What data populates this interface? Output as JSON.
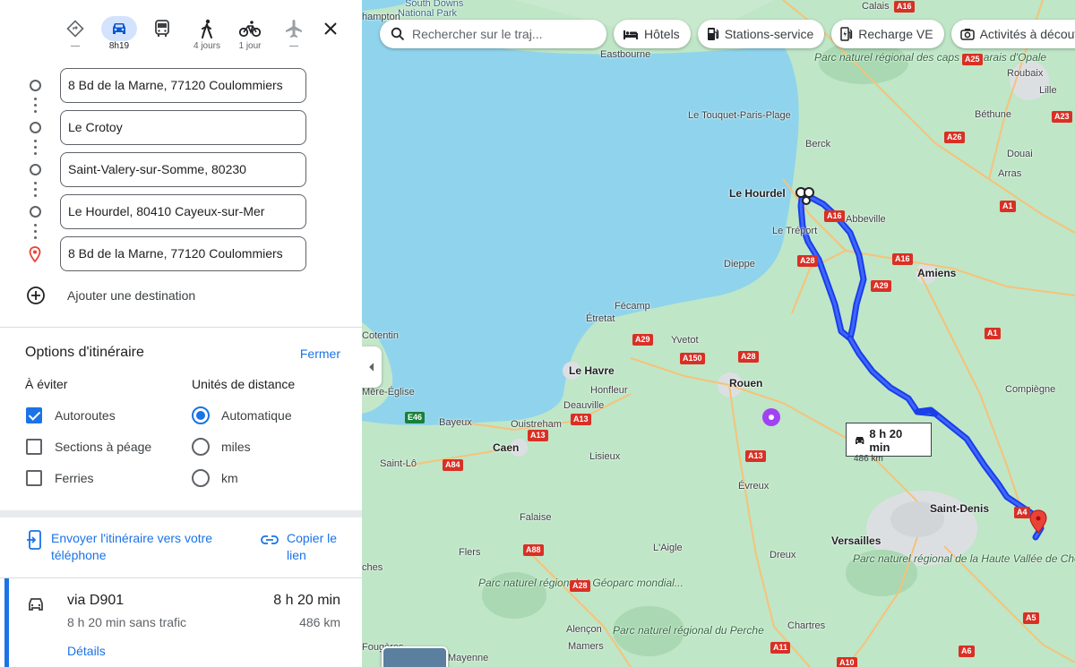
{
  "modes": [
    {
      "name": "best",
      "label": "—"
    },
    {
      "name": "driving",
      "label": "8h19"
    },
    {
      "name": "transit",
      "label": ""
    },
    {
      "name": "walking",
      "label": "4 jours"
    },
    {
      "name": "cycling",
      "label": "1 jour"
    },
    {
      "name": "flights",
      "label": "—"
    }
  ],
  "stops": [
    "8 Bd de la Marne, 77120 Coulommiers",
    "Le Crotoy",
    "Saint-Valery-sur-Somme, 80230",
    "Le Hourdel, 80410 Cayeux-sur-Mer",
    "8 Bd de la Marne, 77120 Coulommiers"
  ],
  "add_destination": "Ajouter une destination",
  "options": {
    "title": "Options d'itinéraire",
    "close": "Fermer",
    "avoid_title": "À éviter",
    "units_title": "Unités de distance",
    "avoid": [
      {
        "label": "Autoroutes",
        "checked": true
      },
      {
        "label": "Sections à péage",
        "checked": false
      },
      {
        "label": "Ferries",
        "checked": false
      }
    ],
    "units": [
      {
        "label": "Automatique",
        "selected": true
      },
      {
        "label": "miles",
        "selected": false
      },
      {
        "label": "km",
        "selected": false
      }
    ]
  },
  "share": {
    "send": "Envoyer l'itinéraire vers votre téléphone",
    "copy": "Copier le lien"
  },
  "route": {
    "via": "via D901",
    "time": "8 h 20 min",
    "sub": "8 h 20 min sans trafic",
    "distance": "486 km",
    "details": "Détails"
  },
  "map": {
    "search_placeholder": "Rechercher sur le traj...",
    "chips": [
      "Hôtels",
      "Stations-service",
      "Recharge VE",
      "Activités à découvrir"
    ],
    "callout_time": "8 h 20 min",
    "callout_distance": "486 km",
    "places": [
      "South Downs",
      "National Park",
      "hampton",
      "Eastbourne",
      "Calais",
      "Roubaix",
      "Lille",
      "Parc naturel régional des caps et marais d'Opale",
      "Le Touquet-Paris-Plage",
      "Béthune",
      "Berck",
      "Douai",
      "Arras",
      "Le Hourdel",
      "Abbeville",
      "Le Tréport",
      "Dieppe",
      "Amiens",
      "Fécamp",
      "Étretat",
      "Yvetot",
      "Cotentin",
      "Le Havre",
      "Honfleur",
      "Rouen",
      "Deauville",
      "Compiègne",
      "Mère-Église",
      "Bayeux",
      "Ouistreham",
      "Caen",
      "Lisieux",
      "Saint-Lô",
      "Évreux",
      "Saint-Denis",
      "Falaise",
      "L'Aigle",
      "Flers",
      "Dreux",
      "Versailles",
      "Parc naturel régional de la Haute Vallée de Chevreuse",
      "ches",
      "Parc naturel régional et Géoparc mondial...",
      "Alençon",
      "Parc naturel régional du Perche",
      "Chartres",
      "Mamers",
      "Fougères",
      "Mayenne"
    ],
    "roads": [
      "A16",
      "A25",
      "A23",
      "A26",
      "A1",
      "A16",
      "A29",
      "A28",
      "A16",
      "A29",
      "A150",
      "A28",
      "A13",
      "E46",
      "A13",
      "A84",
      "A13",
      "A88",
      "A28",
      "A4",
      "A5",
      "A11",
      "A10",
      "A6",
      "A1"
    ]
  },
  "colors": {
    "accent": "#1a73e8",
    "route": "#1a3ee8",
    "sea": "#8fd4ec",
    "land": "#bfe6c7",
    "urban": "#dcdfe2",
    "destination_pin": "#ea4335"
  }
}
